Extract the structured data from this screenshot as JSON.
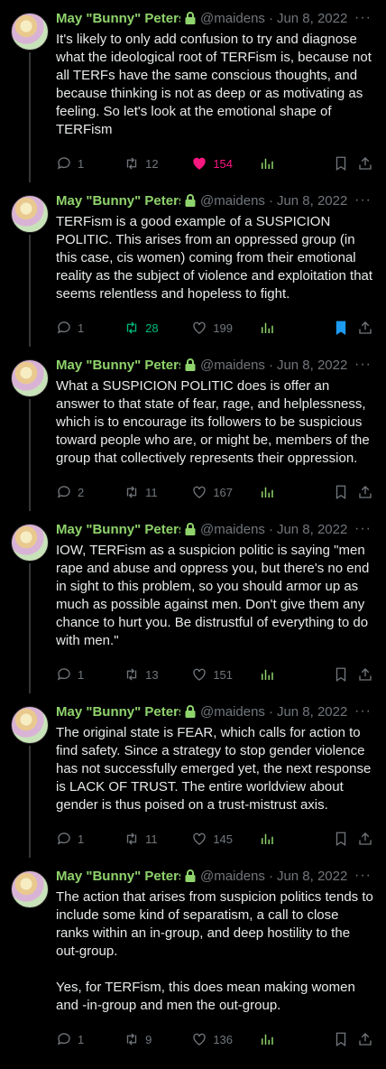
{
  "author": {
    "name": "May \"Bunny\" Peters",
    "handle": "@maidens",
    "date": "Jun 8, 2022"
  },
  "colors": {
    "name": "#8fd36c",
    "muted": "#71767b",
    "retweet_active": "#00ba7c",
    "like_active": "#f91880",
    "bookmark_active": "#1d9bf0"
  },
  "icons": [
    "lock-icon",
    "more-icon",
    "reply-icon",
    "retweet-icon",
    "like-icon",
    "views-icon",
    "bookmark-icon",
    "share-icon"
  ],
  "tweets": [
    {
      "text": "It's likely to only add confusion to try and diagnose what the ideological root of TERFism is, because not all TERFs have the same conscious thoughts, and because thinking is not as deep or as motivating as feeling. So let's look at the emotional shape of TERFism",
      "replies": "1",
      "retweets": "12",
      "likes": "154",
      "views": "",
      "retweeted": false,
      "liked": true,
      "bookmarked": false
    },
    {
      "text": "TERFism is a good example of a SUSPICION POLITIC. This arises from an oppressed group (in this case, cis women) coming from their emotional reality as the subject of violence and exploitation that seems relentless and hopeless to fight.",
      "replies": "1",
      "retweets": "28",
      "likes": "199",
      "views": "",
      "retweeted": true,
      "liked": false,
      "bookmarked": true
    },
    {
      "text": "What a SUSPICION POLITIC does is offer an answer to that state of fear, rage, and helplessness, which is to encourage its followers to be suspicious toward people who are, or might be, members of the group that collectively represents their oppression.",
      "replies": "2",
      "retweets": "11",
      "likes": "167",
      "views": "",
      "retweeted": false,
      "liked": false,
      "bookmarked": false
    },
    {
      "text": "IOW, TERFism as a suspicion politic is saying \"men rape and abuse and oppress you, but there's no end in sight to this problem, so you should armor up as much as possible against men. Don't give them any chance to hurt you. Be distrustful of everything to do with men.\"",
      "replies": "1",
      "retweets": "13",
      "likes": "151",
      "views": "",
      "retweeted": false,
      "liked": false,
      "bookmarked": false
    },
    {
      "text": "The original state is FEAR, which calls for action to find safety. Since a strategy to stop gender violence has not successfully emerged yet, the next response is LACK OF TRUST. The entire worldview about gender is thus poised on a trust-mistrust axis.",
      "replies": "1",
      "retweets": "11",
      "likes": "145",
      "views": "",
      "retweeted": false,
      "liked": false,
      "bookmarked": false
    },
    {
      "text": "The action that arises from suspicion politics tends to include some kind of separatism, a call to close ranks within an in-group, and deep hostility to the out-group.\n\nYes, for TERFism, this does mean making women and -in-group and men the out-group.",
      "replies": "1",
      "retweets": "9",
      "likes": "136",
      "views": "",
      "retweeted": false,
      "liked": false,
      "bookmarked": false
    }
  ]
}
